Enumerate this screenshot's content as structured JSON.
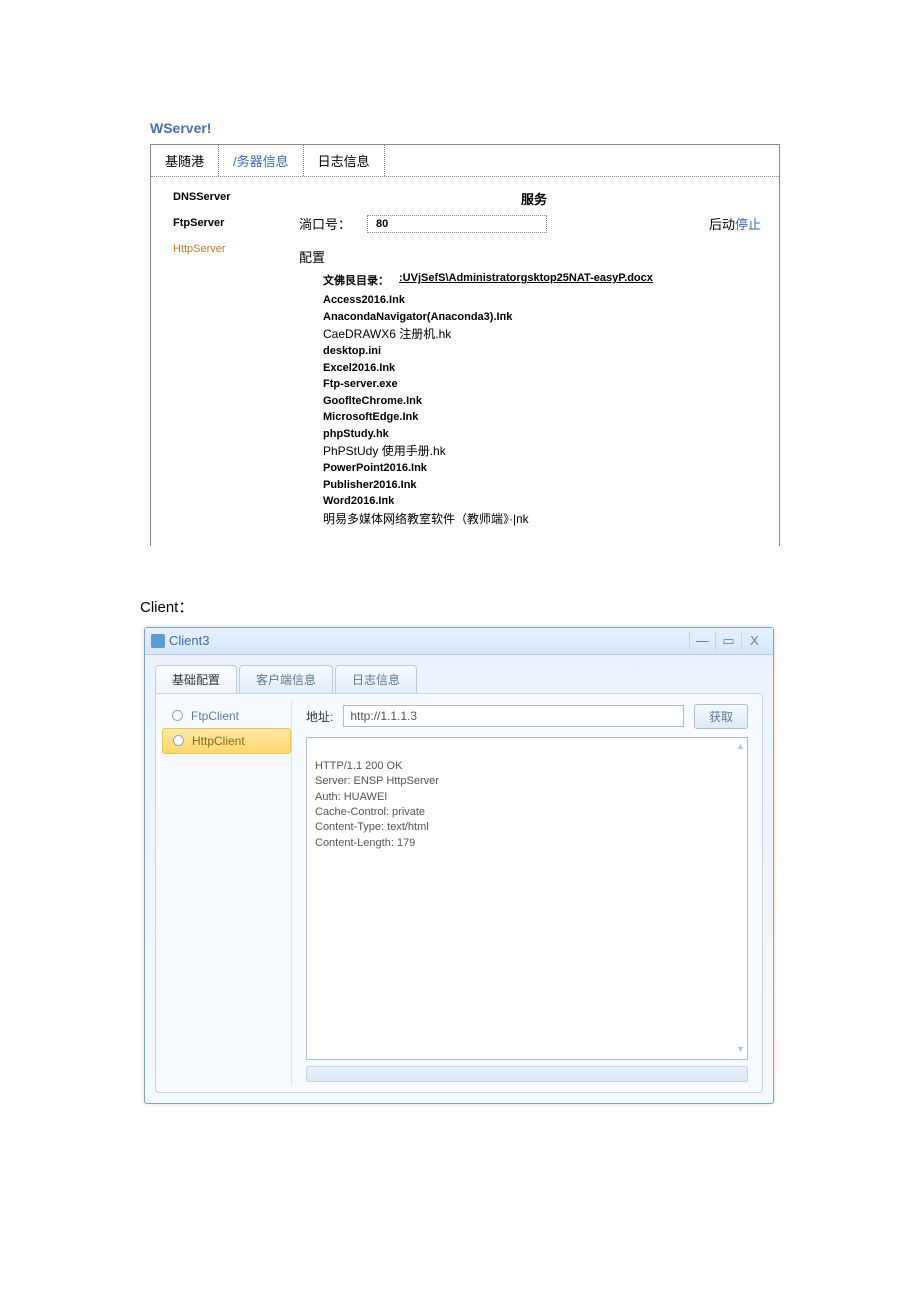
{
  "wserver": {
    "title": "WServer!",
    "tabs": [
      "基随港",
      "/务器信息",
      "日志信息"
    ],
    "sidebar": [
      {
        "label": "DNSServer",
        "active": false
      },
      {
        "label": "FtpServer",
        "active": false
      },
      {
        "label": "HttpServer",
        "active": true
      }
    ],
    "service_header": "服务",
    "port_label": "淌口号：",
    "port_value": "80",
    "start_label": "后动",
    "stop_label": "停止",
    "config_header": "配置",
    "path_label": "文佛艮目录：",
    "path_value": ":UVjSefS\\Administratorgsktop25NAT-easyP.docx",
    "files": [
      "Access2016.Ink",
      "AnacondaNavigator(Aпaconda3).Iпk",
      "CaeDRAWX6 注册机.hk",
      "desktop.ini",
      "Excel2016.Ink",
      "Ftp-server.exe",
      "GooflteChrome.Ink",
      "MicrosoftEdge.Ink",
      "phpStudy.hk",
      "PhPStUdy 使用手册.hk",
      "PowerPoint2016.Ink",
      "Publisher2016.Ink",
      "Word2016.Iпk",
      "明易多媒体网络教室软件（教师端》·|пk"
    ]
  },
  "client": {
    "section_title": "Client：",
    "window_title": "Client3",
    "tabs": [
      "基础配置",
      "客户端信息",
      "日志信息"
    ],
    "sidebar": [
      {
        "label": "FtpClient",
        "active": false
      },
      {
        "label": "HttpClient",
        "active": true
      }
    ],
    "url_label": "地址:",
    "url_value": "http://1.1.1.3",
    "get_button": "获取",
    "response": "HTTP/1.1 200 OK\nServer: ENSP HttpServer\nAuth: HUAWEI\nCache-Control: private\nContent-Type: text/html\nContent-Length: 179"
  }
}
